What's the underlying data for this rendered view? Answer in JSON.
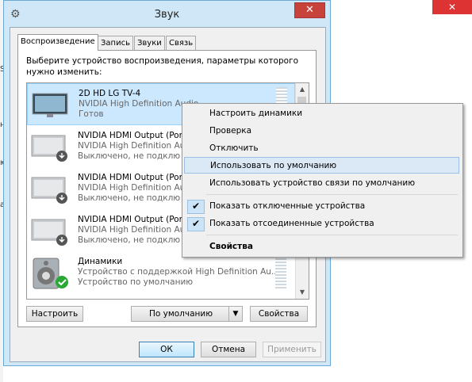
{
  "background": {
    "close_glyph": "✕",
    "fragments": [
      "Se",
      "н.",
      "ю",
      "а"
    ]
  },
  "window": {
    "title": "Звук",
    "close_glyph": "✕"
  },
  "tabs": [
    {
      "label": "Воспроизведение",
      "active": true
    },
    {
      "label": "Запись",
      "active": false
    },
    {
      "label": "Звуки",
      "active": false
    },
    {
      "label": "Связь",
      "active": false
    }
  ],
  "prompt": "Выберите устройство воспроизведения, параметры которого нужно изменить:",
  "devices": [
    {
      "name": "2D HD LG TV-4",
      "driver": "NVIDIA High Definition Audio",
      "status": "Готов",
      "icon": "monitor-icon",
      "selected": true
    },
    {
      "name": "NVIDIA HDMI Output (Por",
      "driver": "NVIDIA High Definition Au",
      "status": "Выключено, не подклю",
      "icon": "monitor-disabled-icon",
      "selected": false
    },
    {
      "name": "NVIDIA HDMI Output (Por",
      "driver": "NVIDIA High Definition Au",
      "status": "Выключено, не подклю",
      "icon": "monitor-disabled-icon",
      "selected": false
    },
    {
      "name": "NVIDIA HDMI Output (Por",
      "driver": "NVIDIA High Definition Au",
      "status": "Выключено, не подклю",
      "icon": "monitor-disabled-icon",
      "selected": false
    },
    {
      "name": "Динамики",
      "driver": "Устройство с поддержкой High Definition Au...",
      "status": "Устройство по умолчанию",
      "icon": "speaker-default-icon",
      "selected": false
    }
  ],
  "buttons": {
    "configure": "Настроить",
    "set_default": "По умолчанию",
    "properties": "Свойства",
    "ok": "ОК",
    "cancel": "Отмена",
    "apply": "Применить"
  },
  "context_menu": {
    "items": [
      {
        "label": "Настроить динамики"
      },
      {
        "label": "Проверка"
      },
      {
        "label": "Отключить"
      },
      {
        "label": "Использовать по умолчанию",
        "hover": true
      },
      {
        "label": "Использовать устройство связи по умолчанию"
      },
      {
        "label": "Показать отключенные устройства",
        "checked": true
      },
      {
        "label": "Показать отсоединенные устройства",
        "checked": true
      },
      {
        "label": "Свойства",
        "bold": true
      }
    ],
    "check_glyph": "✔"
  },
  "colors": {
    "accent": "#cce8ff",
    "close_red": "#c7423a",
    "check_green": "#2aa836"
  }
}
